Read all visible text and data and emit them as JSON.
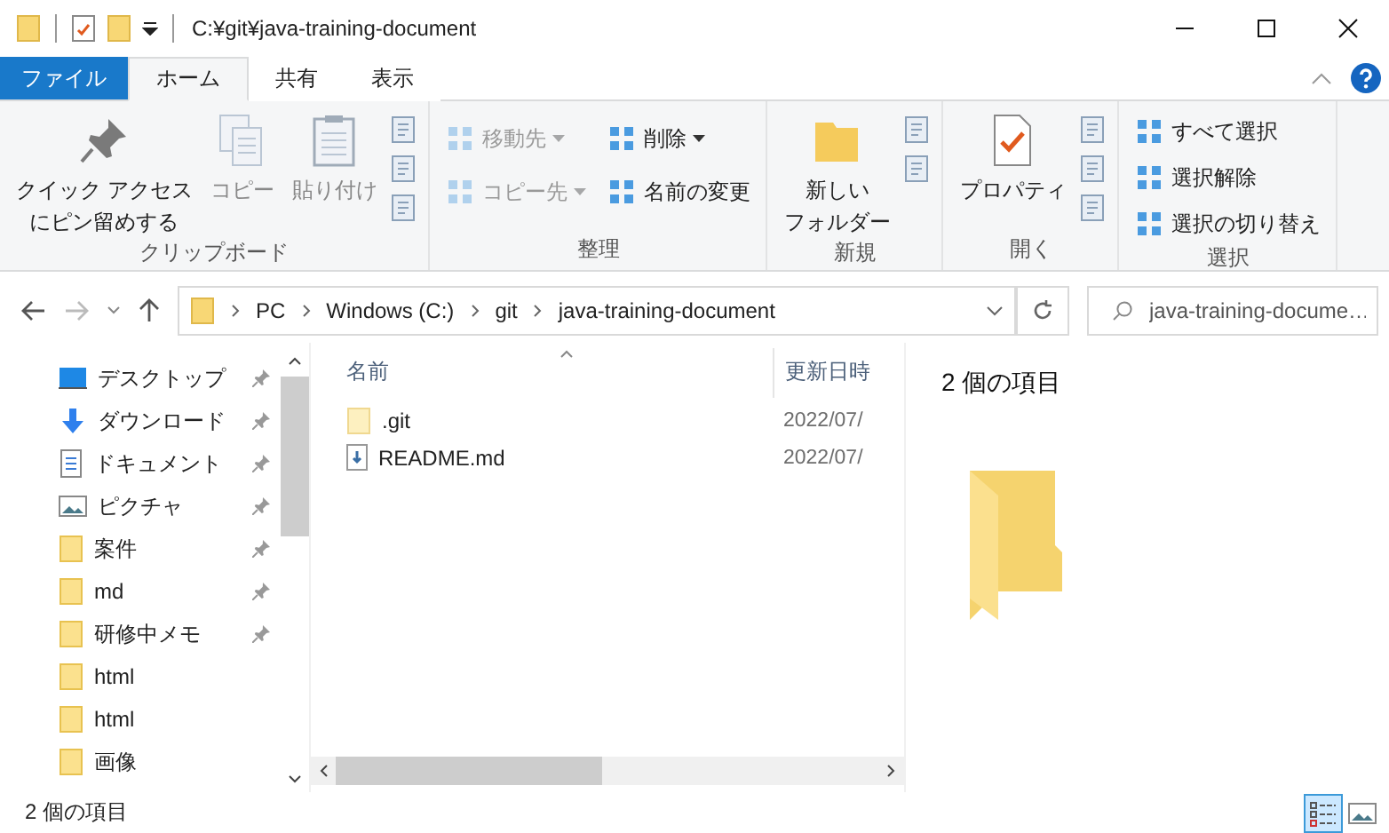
{
  "window": {
    "title": "C:¥git¥java-training-document"
  },
  "ribbon_tabs": [
    {
      "label": "ファイル",
      "kind": "file",
      "selected": false
    },
    {
      "label": "ホーム",
      "kind": "tab",
      "selected": true
    },
    {
      "label": "共有",
      "kind": "tab",
      "selected": false
    },
    {
      "label": "表示",
      "kind": "tab",
      "selected": false
    }
  ],
  "ribbon_groups": [
    {
      "label": "クリップボード",
      "items": [
        {
          "kind": "large",
          "lines": [
            "クイック アクセス",
            "にピン留めする"
          ],
          "disabled": false
        },
        {
          "kind": "large",
          "lines": [
            "コピー"
          ],
          "disabled": true
        },
        {
          "kind": "large",
          "lines": [
            "貼り付け"
          ],
          "disabled": true
        },
        {
          "kind": "icons"
        }
      ]
    },
    {
      "label": "整理",
      "items": [
        {
          "kind": "small",
          "label": "移動先",
          "dropdown": true,
          "disabled": true
        },
        {
          "kind": "small",
          "label": "コピー先",
          "dropdown": true,
          "disabled": true
        },
        {
          "kind": "small",
          "label": "削除",
          "dropdown": true,
          "disabled": false
        },
        {
          "kind": "small",
          "label": "名前の変更",
          "dropdown": false,
          "disabled": false
        }
      ]
    },
    {
      "label": "新規",
      "items": [
        {
          "kind": "large",
          "lines": [
            "新しい",
            "フォルダー"
          ],
          "disabled": false
        },
        {
          "kind": "icons"
        }
      ]
    },
    {
      "label": "開く",
      "items": [
        {
          "kind": "large",
          "lines": [
            "プロパティ"
          ],
          "disabled": false
        },
        {
          "kind": "icons"
        }
      ]
    },
    {
      "label": "選択",
      "items": [
        {
          "kind": "small",
          "label": "すべて選択",
          "dropdown": false,
          "disabled": false
        },
        {
          "kind": "small",
          "label": "選択解除",
          "dropdown": false,
          "disabled": false
        },
        {
          "kind": "small",
          "label": "選択の切り替え",
          "dropdown": false,
          "disabled": false
        }
      ]
    }
  ],
  "address_bar": {
    "crumbs": [
      "PC",
      "Windows (C:)",
      "git",
      "java-training-document"
    ]
  },
  "search": {
    "placeholder": "java-training-docume…"
  },
  "nav_pane": {
    "items": [
      {
        "label": "デスクトップ",
        "kind": "desktop",
        "pinned": true
      },
      {
        "label": "ダウンロード",
        "kind": "download",
        "pinned": true
      },
      {
        "label": "ドキュメント",
        "kind": "document",
        "pinned": true
      },
      {
        "label": "ピクチャ",
        "kind": "picture",
        "pinned": true
      },
      {
        "label": "案件",
        "kind": "folder",
        "pinned": true
      },
      {
        "label": "md",
        "kind": "folder",
        "pinned": true
      },
      {
        "label": "研修中メモ",
        "kind": "folder",
        "pinned": true
      },
      {
        "label": "html",
        "kind": "folder",
        "pinned": false
      },
      {
        "label": "html",
        "kind": "folder",
        "pinned": false
      },
      {
        "label": "画像",
        "kind": "folder",
        "pinned": false
      }
    ]
  },
  "file_list": {
    "columns": [
      "名前",
      "更新日時"
    ],
    "rows": [
      {
        "name": ".git",
        "kind": "folder",
        "modified": "2022/07/"
      },
      {
        "name": "README.md",
        "kind": "file",
        "modified": "2022/07/"
      }
    ]
  },
  "preview": {
    "title": "2 個の項目"
  },
  "status_bar": {
    "text": "2 個の項目",
    "views": [
      {
        "kind": "details",
        "selected": true
      },
      {
        "kind": "large_icons",
        "selected": false
      }
    ]
  }
}
